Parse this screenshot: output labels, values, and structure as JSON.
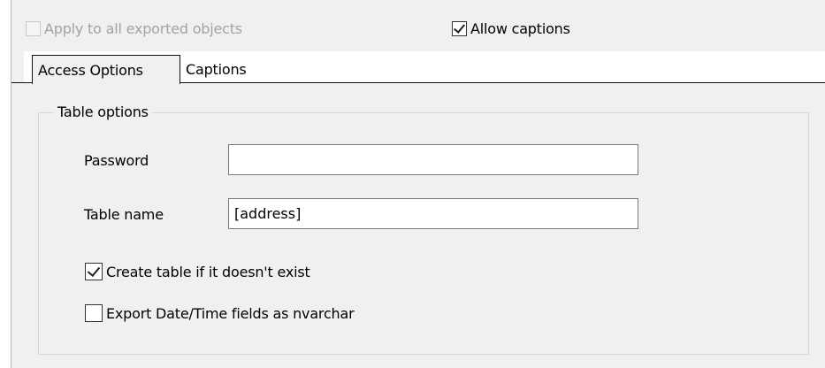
{
  "top_options": {
    "apply_all": {
      "label": "Apply to all exported objects",
      "checked": false,
      "disabled": true
    },
    "allow_captions": {
      "label": "Allow captions",
      "checked": true
    }
  },
  "tabs": [
    {
      "label": "Access Options",
      "active": true
    },
    {
      "label": "Captions",
      "active": false
    }
  ],
  "table_options": {
    "title": "Table options",
    "password": {
      "label": "Password",
      "value": ""
    },
    "table_name": {
      "label": "Table name",
      "value": "[address]"
    },
    "create_table": {
      "label": "Create table if it doesn't exist",
      "checked": true
    },
    "export_datetime": {
      "label": "Export Date/Time fields as nvarchar",
      "checked": false
    }
  }
}
